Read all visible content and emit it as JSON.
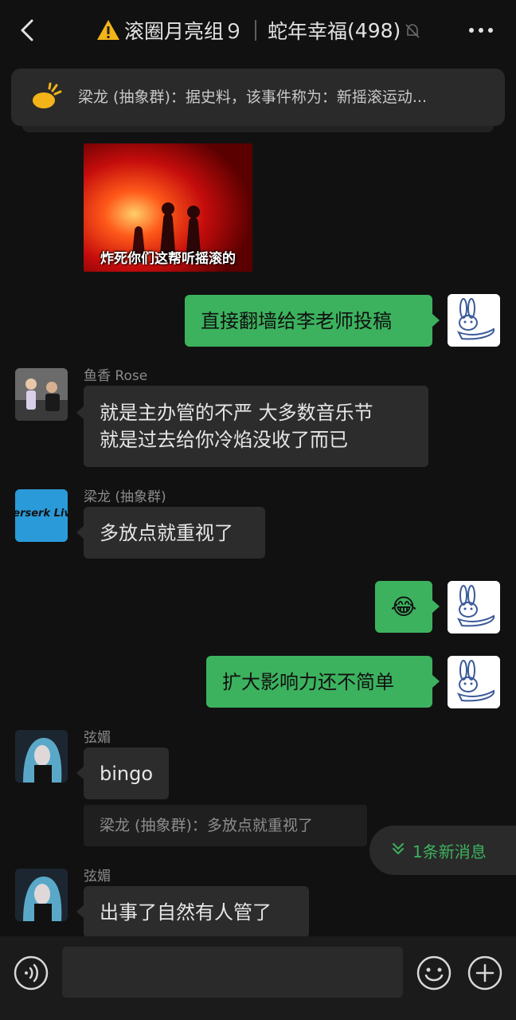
{
  "header": {
    "group_name": "滚圈月亮组９",
    "group_suffix": "蛇年幸福",
    "member_count": "(498)",
    "back_icon": "chevron-left-icon",
    "warning_icon": "warning-icon",
    "mute_icon": "bell-off-icon",
    "more_icon": "more-icon"
  },
  "pinned": {
    "icon": "announcement-icon",
    "text": "梁龙 (抽象群)：据史料，该事件称为：新摇滚运动..."
  },
  "messages": [
    {
      "type": "image",
      "side": "left",
      "caption": "炸死你们这帮听摇滚的"
    },
    {
      "type": "text",
      "side": "right",
      "text": "直接翻墙给李老师投稿"
    },
    {
      "type": "text",
      "side": "left",
      "sender": "鱼香 Rose",
      "lines": [
        "就是主办管的不严  大多数音乐节",
        "就是过去给你冷焰没收了而已"
      ]
    },
    {
      "type": "text",
      "side": "left",
      "sender": "梁龙 (抽象群)",
      "avatar_text": "Berserk Live",
      "text": "多放点就重视了"
    },
    {
      "type": "emoji",
      "side": "right",
      "emoji": "😂"
    },
    {
      "type": "text",
      "side": "right",
      "text": "扩大影响力还不简单"
    },
    {
      "type": "text",
      "side": "left",
      "sender": "弦媚",
      "text": "bingo",
      "quote": "梁龙 (抽象群)：多放点就重视了"
    },
    {
      "type": "text",
      "side": "left",
      "sender": "弦媚",
      "text": "出事了自然有人管了"
    }
  ],
  "new_messages": {
    "label": "1条新消息",
    "icon": "double-chevron-down-icon"
  },
  "input_bar": {
    "voice_icon": "voice-icon",
    "emoji_icon": "emoji-icon",
    "plus_icon": "plus-icon",
    "input_value": ""
  },
  "colors": {
    "green": "#3cb25e",
    "background": "#111111",
    "bubble_gray": "#2c2c2c"
  }
}
